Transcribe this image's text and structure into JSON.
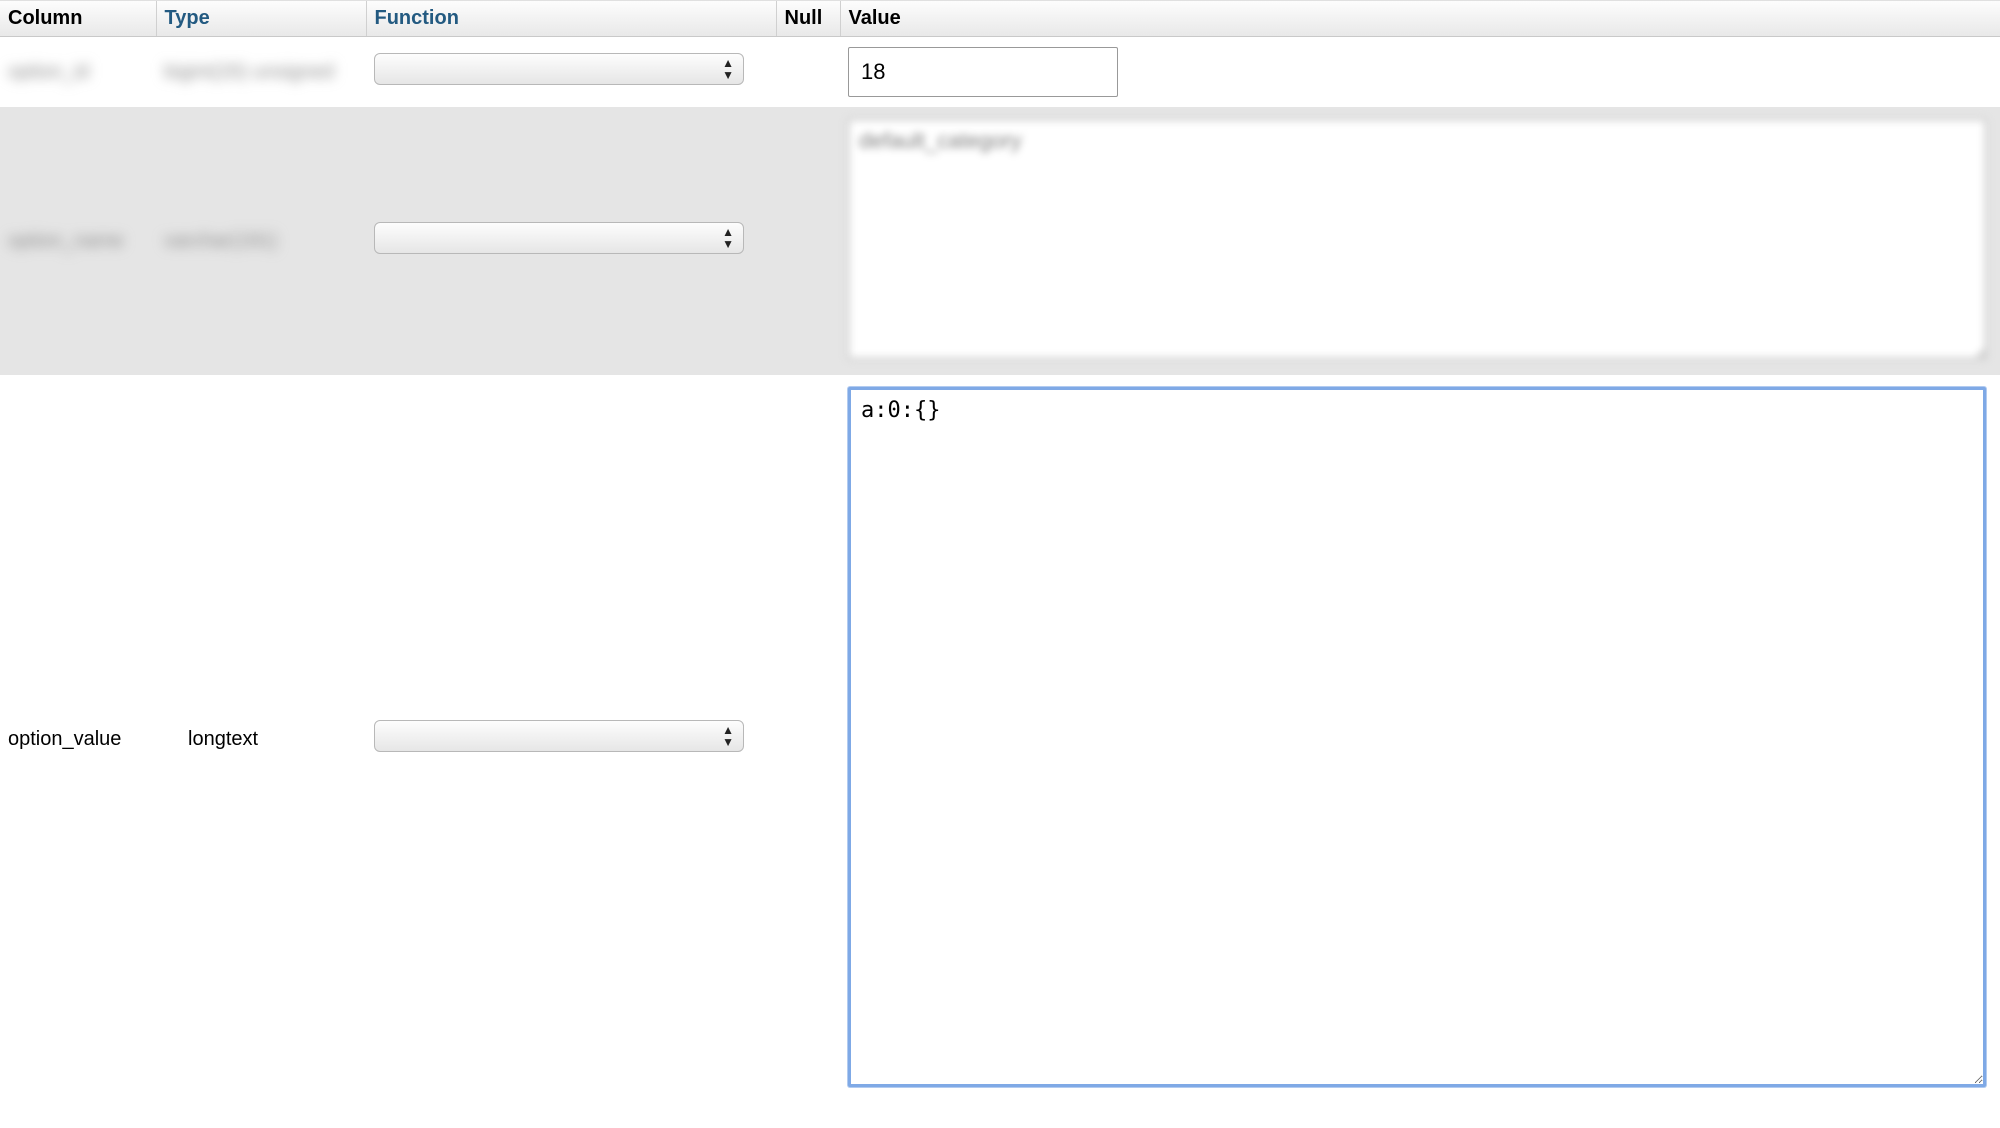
{
  "headers": {
    "column": "Column",
    "type": "Type",
    "function": "Function",
    "null": "Null",
    "value": "Value"
  },
  "rows": [
    {
      "column": "option_id",
      "type": "bigint(20) unsigned",
      "blurred": true,
      "function": "",
      "null": false,
      "value": "18",
      "input_kind": "text"
    },
    {
      "column": "option_name",
      "type": "varchar(191)",
      "blurred": true,
      "function": "",
      "null": false,
      "value": "default_category",
      "input_kind": "textarea_medium",
      "value_blurred": true
    },
    {
      "column": "option_value",
      "type": "longtext",
      "blurred": false,
      "function": "",
      "null": false,
      "value": "a:0:{}",
      "input_kind": "textarea_large"
    }
  ]
}
